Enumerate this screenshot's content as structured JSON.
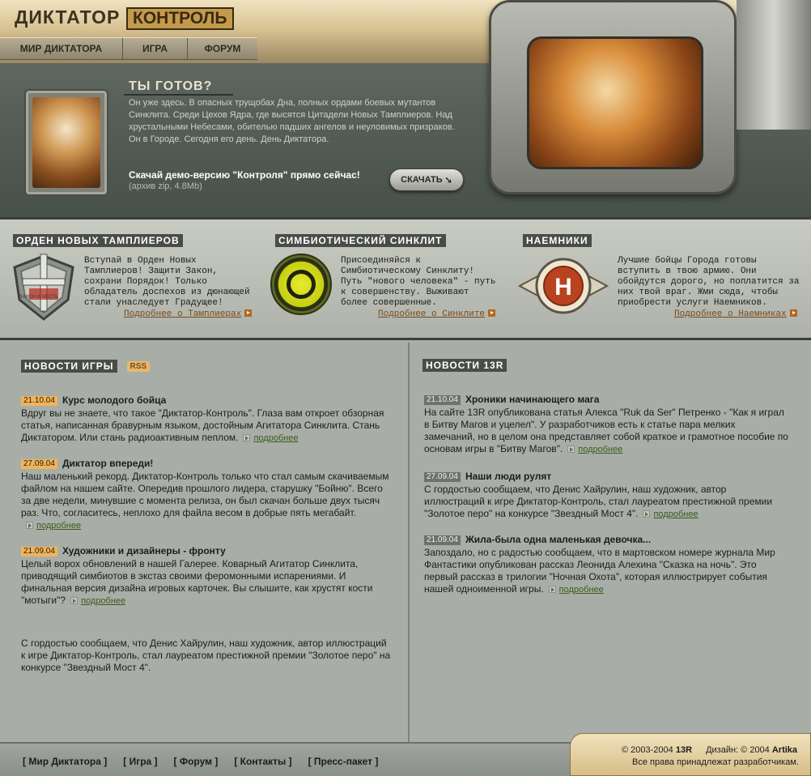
{
  "header": {
    "logo_title": "ДИКТАТОР",
    "logo_subtitle": "КОНТРОЛЬ",
    "nav": [
      "МИР ДИКТАТОРА",
      "ИГРА",
      "ФОРУМ"
    ]
  },
  "promo": {
    "title": "ТЫ ГОТОВ?",
    "text_1": "Он уже здесь. В опасных трущобах Дна, полных ордами боевых мутантов Синклита. Среди Цехов Ядра, где высятся Цитадели Новых Тамплиеров. Над хрустальными Небесами, обителью падших ангелов и неуловимых призраков.",
    "text_2": "Он в Городе. Сегодня его день. День Диктатора.",
    "cta": "Скачай демо-версию \"Контроля\" прямо сейчас!",
    "file_info": "(архив zip, 4.8Mb)",
    "download_label": "СКАЧАТЬ"
  },
  "factions": [
    {
      "title": "ОРДЕН НОВЫХ ТАМПЛИЕРОВ",
      "text": "Вступай в Орден Новых Тамплиеров! Защити Закон, сохрани Порядок! Только обладатель доспехов из дюнающей стали унаследует Градущее!",
      "link": "Подробнее о Тамплиерах",
      "emblem_text": "ЗАКОН И ЧЕСТЬ"
    },
    {
      "title": "СИМБИОТИЧЕСКИЙ СИНКЛИТ",
      "text": "Присоединяйся к Симбиотическому Синклиту! Путь \"нового человека\" - путь к совершенству. Выживают более совершенные.",
      "link": "Подробнее о Синклите"
    },
    {
      "title": "НАЕМНИКИ",
      "text": "Лучшие бойцы Города готовы вступить в твою армию. Они обойдутся дорого, но поплатится за них твой враг. Жми сюда, чтобы приобрести услуги Наемников.",
      "link": "Подробнее о Наемниках",
      "emblem_letter": "H"
    }
  ],
  "game_news": {
    "heading": "НОВОСТИ ИГРЫ",
    "rss_label": "RSS",
    "items": [
      {
        "date": "21.10.04",
        "title": "Курс молодого бойца",
        "body": "Вдруг вы не знаете, что такое \"Диктатор-Контроль\". Глаза вам откроет обзорная статья, написанная бравурным языком, достойным Агитатора Синклита. Стань Диктатором. Или стань радиоактивным пеплом.",
        "more": "подробнее"
      },
      {
        "date": "27.09.04",
        "title": "Диктатор впереди!",
        "body": "Наш маленький рекорд. Диктатор-Контроль только что стал самым скачиваемым файлом на нашем сайте. Опередив прошлого лидера, старушку \"Бойню\". Всего за две недели, минувшие с момента релиза, он был скачан больше двух тысяч раз. Что, согласитесь, неплохо для файла весом в добрые пять мегабайт.",
        "more": "подробнее"
      },
      {
        "date": "21.09.04",
        "title": "Художники и дизайнеры - фронту",
        "body": "Целый ворох обновлений в нашей Галерее. Коварный Агитатор Синклита, приводящий симбиотов в экстаз своими феромонными испарениями. И финальная версия дизайна игровых карточек. Вы слышите, как хрустят кости \"мотыги\"?",
        "more": "подробнее"
      }
    ],
    "extra": "С гордостью сообщаем, что  Денис Хайрулин, наш художник, автор иллюстраций к игре Диктатор-Контроль, стал лауреатом престижной премии \"Золотое перо\" на конкурсе \"Звездный Мост 4\"."
  },
  "studio_news": {
    "heading": "НОВОСТИ 13R",
    "items": [
      {
        "date": "21.10.04",
        "title": "Хроники начинающего мага",
        "body": "На сайте 13R опубликована статья Алекса \"Ruk da Ser\" Петренко - \"Как я играл в Битву Магов и уцелел\". У разработчиков есть к статье пара мелких замечаний, но в целом она представляет собой краткое и грамотное пособие по основам игры в \"Битву Магов\".",
        "more": "подробнее"
      },
      {
        "date": "27.09.04",
        "title": "Наши люди рулят",
        "body": "С гордостью сообщаем, что  Денис Хайрулин, наш художник, автор иллюстраций к игре Диктатор-Контроль, стал лауреатом престижной премии \"Золотое перо\" на конкурсе \"Звездный Мост 4\".",
        "more": "подробнее"
      },
      {
        "date": "21.09.04",
        "title": "Жила-была одна маленькая девочка...",
        "body": "Запоздало, но с радостью сообщаем, что в мартовском номере журнала Мир Фантастики опубликован рассказ Леонида Алехина \"Сказка на ночь\". Это первый рассказ в трилогии \"Ночная Охота\", которая иллюстрирует события нашей одноименной игры.",
        "more": "подробнее"
      }
    ]
  },
  "footer": {
    "links": [
      "[ Мир Диктатора ]",
      "[ Игра ]",
      "[ Форум ]",
      "[ Контакты ]",
      "[ Пресс-пакет ]"
    ],
    "copyright_prefix": "© 2003-2004",
    "copyright_company": "13R",
    "design_prefix": "Дизайн: © 2004",
    "design_company": "Artika",
    "rights": "Все права принадлежат разработчикам."
  }
}
